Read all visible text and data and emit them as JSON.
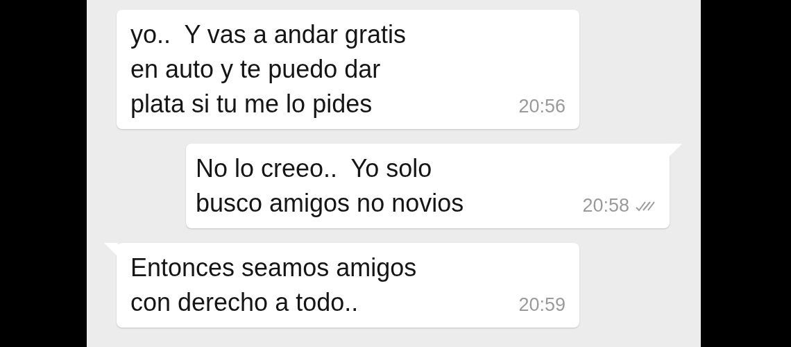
{
  "messages": [
    {
      "kind": "incoming",
      "tail": false,
      "text": "yo..  Y vas a andar gratis\nen auto y te puedo dar\nplata si tu me lo pides",
      "time": "20:56"
    },
    {
      "kind": "outgoing",
      "tail": true,
      "text": "No lo creeo..  Yo solo\nbusco amigos no novios",
      "time": "20:58",
      "read": false
    },
    {
      "kind": "incoming",
      "tail": true,
      "text": "Entonces seamos amigos\ncon derecho a todo..",
      "time": "20:59"
    }
  ]
}
